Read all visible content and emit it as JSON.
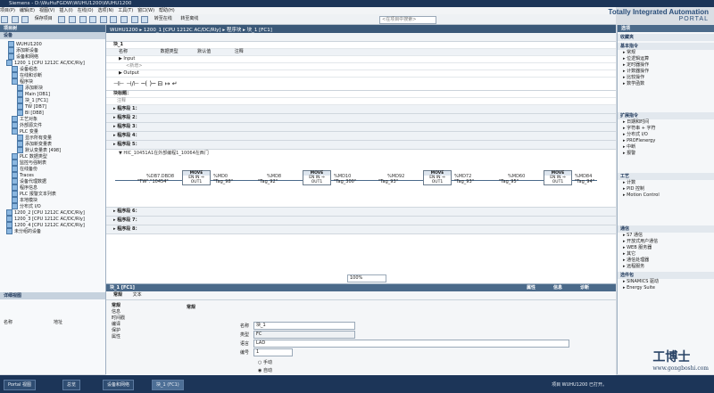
{
  "window": {
    "title": "Siemens - D:\\WuHuFGDW\\WUHU1200\\WUHU1200"
  },
  "menu": [
    "项目(P)",
    "编辑(E)",
    "视图(V)",
    "插入(I)",
    "在线(O)",
    "选项(N)",
    "工具(T)",
    "窗口(W)",
    "帮助(H)"
  ],
  "toolbar": {
    "save_label": "保存项目",
    "online": "转至在线",
    "offline": "转至离线",
    "search_placeholder": "<在项目中搜索>"
  },
  "brand": {
    "line1": "Totally Integrated Automation",
    "line2": "PORTAL"
  },
  "left_panel": {
    "title": "项目树",
    "devices_tab": "设备",
    "tree": [
      "WUHU1200",
      "添加新设备",
      "设备和网络",
      "1200_1 [CPU 1212C AC/DC/Rly]",
      "设备组态",
      "在线和诊断",
      "程序块",
      "添加新块",
      "Main [OB1]",
      "块_1 [FC1]",
      "TW [DB7]",
      "Bl [DB8]",
      "工艺对象",
      "外部源文件",
      "PLC 变量",
      "显示所有变量",
      "添加新变量表",
      "默认变量表 [498]",
      "PLC 数据类型",
      "监控与强制表",
      "在线备份",
      "Traces",
      "设备代理数据",
      "程序信息",
      "PLC 报警文本列表",
      "本地模块",
      "分布式 I/O",
      "1200_2 [CPU 1212C AC/DC/Rly]",
      "1200_3 [CPU 1212C AC/DC/Rly]",
      "1200_4 [CPU 1212C AC/DC/Rly]",
      "未分组的设备"
    ],
    "detail_title": "详细视图",
    "detail_cols": [
      "名称",
      "地址"
    ]
  },
  "editor": {
    "breadcrumb": "WUHU1200 ▸ 1200_1 [CPU 1212C AC/DC/Rly] ▸ 程序块 ▸ 块_1 [FC1]",
    "block_name": "块_1",
    "iface_cols": [
      "名称",
      "数据类型",
      "默认值",
      "注释"
    ],
    "iface_rows": [
      "▶ Input",
      "<新增>",
      "▶ Output"
    ],
    "block_title": "块标题：",
    "comment": "注释",
    "networks": [
      "程序段 1：",
      "程序段 2：",
      "程序段 3：",
      "程序段 4：",
      "程序段 5："
    ],
    "net5_title": "▼ HIC_10451A1在外部编程1_10064在西门",
    "move_blocks": [
      {
        "title": "MOVE",
        "en": "EN",
        "in_tag": "\"TW\".\"10454\"",
        "addr": "%DB7.DBD8",
        "out_addr": "%MD0",
        "out_tag": "\"Tag_98\""
      },
      {
        "title": "MOVE",
        "en": "EN",
        "in_tag": "\"Tag_92\"",
        "addr": "%MD8",
        "out_addr": "%MD10",
        "out_tag": "\"Tag_300\""
      },
      {
        "title": "MOVE",
        "en": "EN",
        "in_tag": "\"Tag_93\"",
        "addr": "%MD92",
        "out_addr": "%MD72",
        "out_tag": "\"Tag_93\""
      },
      {
        "title": "MOVE",
        "en": "EN",
        "in_tag": "\"Tag_95\"",
        "addr": "%MD60",
        "out_addr": "%MD84",
        "out_tag": "\"Tag_94\""
      }
    ],
    "more_networks": [
      "程序段 6：",
      "程序段 7：",
      "程序段 8："
    ],
    "zoom": "100%"
  },
  "properties": {
    "header": "块_1 [FC1]",
    "tabs": [
      "属性",
      "信息",
      "诊断"
    ],
    "subtabs": [
      "常规",
      "文本"
    ],
    "nav": [
      "常规",
      "信息",
      "时间戳",
      "编译",
      "保护",
      "属性"
    ],
    "section": "常规",
    "fields": {
      "name_label": "名称",
      "name_value": "块_1",
      "type_label": "类型",
      "type_value": "FC",
      "lang_label": "语言",
      "lang_value": "LAD",
      "number_label": "编号",
      "number_value": "1",
      "manual": "手动",
      "auto": "自动"
    }
  },
  "right_panel": {
    "title": "选项",
    "favorites": "收藏夹",
    "basic": "基本指令",
    "basic_items": [
      "常规",
      "位逻辑运算",
      "定时器操作",
      "计数器操作",
      "比较操作",
      "数学函数"
    ],
    "extended": "扩展指令",
    "extended_items": [
      "日期和时间",
      "字符串 + 字符",
      "分布式 I/O",
      "PROFIenergy",
      "中断",
      "报警"
    ],
    "tech": "工艺",
    "tech_items": [
      "计数",
      "PID 控制",
      "Motion Control"
    ],
    "comm": "通信",
    "comm_items": [
      "S7 通信",
      "开放式用户通信",
      "WEB 服务器",
      "其它",
      "通信处理器",
      "远程服务"
    ],
    "optional": "选件包",
    "optional_items": [
      "SINAMICS 驱动",
      "Energy Suite"
    ]
  },
  "statusbar": {
    "portal": "Portal 视图",
    "overview": "总览",
    "tab1": "设备和网络",
    "tab2": "块_1 (FC1)",
    "message": "项目 WUHU1200 已打开。"
  },
  "watermark": {
    "text": "工博士",
    "sub": "www.gongboshi.com"
  }
}
